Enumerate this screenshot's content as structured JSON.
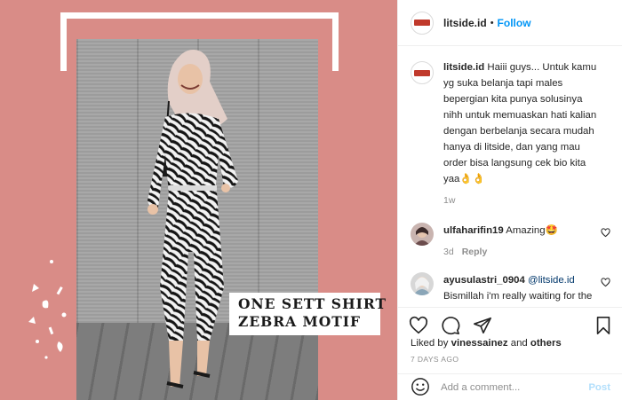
{
  "image": {
    "caption_line1": "ONE SETT SHIRT",
    "caption_line2": "ZEBRA MOTIF",
    "background_color": "#d98c87"
  },
  "header": {
    "username": "litside.id",
    "separator": "•",
    "follow_label": "Follow"
  },
  "caption": {
    "username": "litside.id",
    "text": "Haiii guys... Untuk kamu yg suka belanja tapi males bepergian kita punya solusinya nihh untuk memuaskan hati kalian dengan berbelanja secara mudah hanya di litside, dan yang mau order bisa langsung cek bio kita yaa👌👌",
    "time": "1w"
  },
  "comments": [
    {
      "username": "ulfaharifin19",
      "text": "Amazing🤩",
      "time": "3d",
      "reply_label": "Reply"
    },
    {
      "username": "ayusulastri_0904",
      "mention": "@litside.id",
      "text": "Bismillah i'm really waiting for the giveaway i'm very happy makanya dari awal aku langsung ikutan giveawaynya karena berharap banget bisa memenangkan baju"
    }
  ],
  "likes": {
    "prefix": "Liked by",
    "user": "vinessainez",
    "connector": "and",
    "others": "others"
  },
  "post_date": "7 DAYS AGO",
  "add_comment": {
    "placeholder": "Add a comment...",
    "post_label": "Post"
  },
  "colors": {
    "follow_blue": "#0095f6",
    "post_disabled": "#b2dffc",
    "meta_gray": "#8e8e8e"
  },
  "icons": [
    "heart-icon",
    "comment-icon",
    "share-icon",
    "bookmark-icon",
    "emoji-icon"
  ]
}
